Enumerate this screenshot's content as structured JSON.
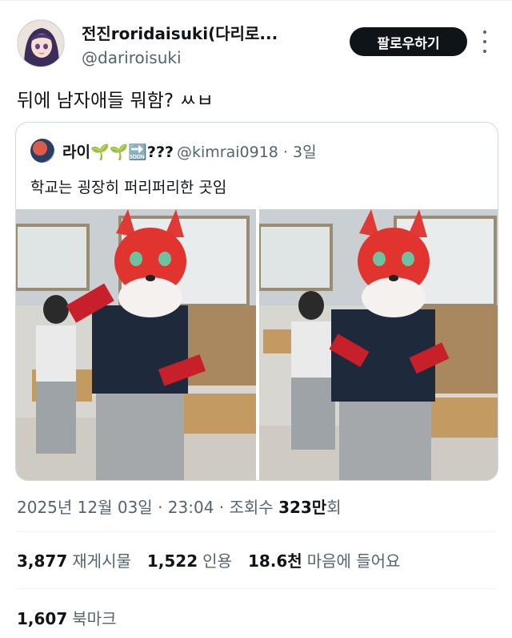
{
  "author": {
    "display_name": "전진roridaisuki(다리로...",
    "handle": "@dariroisuki"
  },
  "follow_label": "팔로우하기",
  "tweet_text": "뒤에 남자애들 뭐함? ㅆㅂ",
  "quote": {
    "name": "라이🌱🌱🔜???",
    "handle": "@kimrai0918 · 3일",
    "text": "학교는 굉장히 퍼리퍼리한 곳임"
  },
  "timestamp": {
    "datetime": "2025년 12월 03일 · 23:04 · 조회수 ",
    "views": "323만",
    "views_suffix": "회"
  },
  "stats": {
    "reposts_count": "3,877",
    "reposts_label": "재게시물",
    "quotes_count": "1,522",
    "quotes_label": "인용",
    "likes_count": "18.6천",
    "likes_label": "마음에 들어요"
  },
  "bookmarks": {
    "count": "1,607",
    "label": "북마크"
  },
  "colors": {
    "text_primary": "#0f1419",
    "text_secondary": "#536471",
    "border": "#cfd9de",
    "button_bg": "#0f1419"
  }
}
